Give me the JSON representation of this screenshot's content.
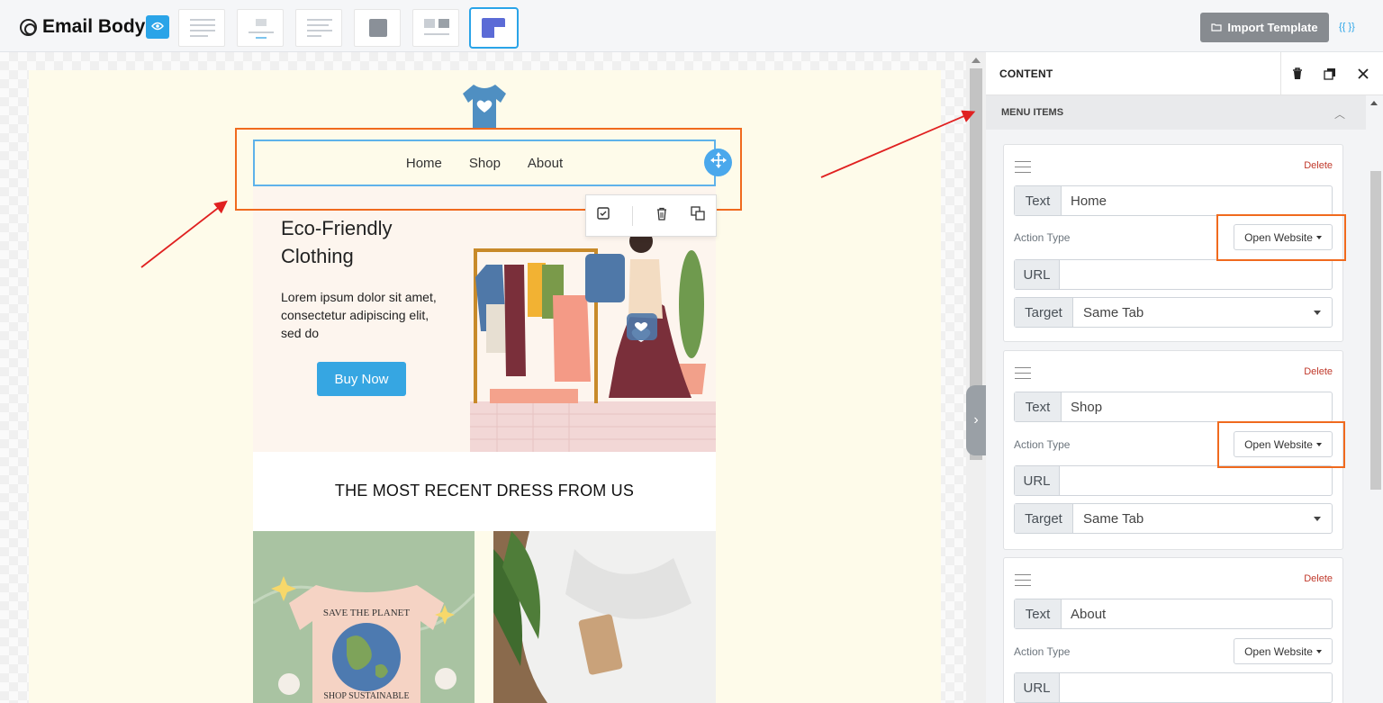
{
  "header": {
    "title": "Email Body",
    "import_label": "Import Template",
    "code_label": "{{ }}"
  },
  "email": {
    "menu": [
      "Home",
      "Shop",
      "About"
    ],
    "hero_title": "Eco-Friendly Clothing",
    "hero_text": "Lorem ipsum dolor sit amet, consectetur adipiscing elit, sed do",
    "buy_label": "Buy Now",
    "recent_title": "THE MOST RECENT DRESS FROM US",
    "tshirt_text_top": "SAVE THE PLANET",
    "tshirt_text_bottom": "SHOP SUSTAINABLE"
  },
  "panel": {
    "title": "CONTENT",
    "section": "MENU ITEMS",
    "delete_label": "Delete",
    "text_label": "Text",
    "action_label": "Action Type",
    "url_label": "URL",
    "target_label": "Target",
    "items": [
      {
        "text": "Home",
        "action": "Open Website",
        "url": "",
        "target": "Same Tab"
      },
      {
        "text": "Shop",
        "action": "Open Website",
        "url": "",
        "target": "Same Tab"
      },
      {
        "text": "About",
        "action": "Open Website",
        "url": ""
      }
    ]
  },
  "colors": {
    "accent": "#2aa4e8",
    "highlight": "#f06a1e",
    "annotation_arrow": "#e02020"
  }
}
